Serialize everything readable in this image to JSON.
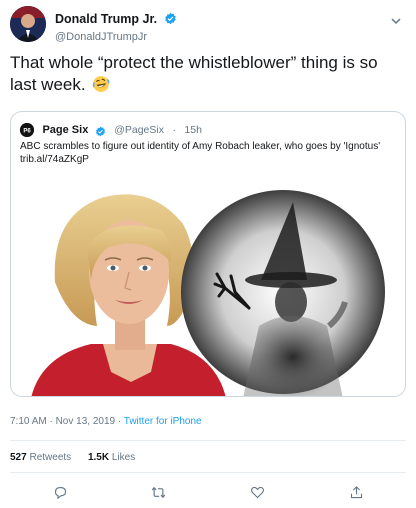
{
  "author": {
    "display_name": "Donald Trump Jr.",
    "handle": "@DonaldJTrumpJr"
  },
  "tweet": {
    "text": "That whole “protect the whistleblower” thing is so last week.",
    "emoji": "rolling-on-floor-laughing"
  },
  "quote": {
    "name": "Page Six",
    "handle": "@PageSix",
    "time": "15h",
    "text": "ABC scrambles to figure out identity of Amy Robach leaker, who goes by 'Ignotus'",
    "link": "trib.al/74aZKgP"
  },
  "meta": {
    "time": "7:10 AM · Nov 13, 2019 · ",
    "source": "Twitter for iPhone"
  },
  "stats": {
    "retweets_count": "527",
    "retweets_label": "Retweets",
    "likes_count": "1.5K",
    "likes_label": "Likes"
  },
  "colors": {
    "accent": "#1da1f2",
    "secondary_text": "#657786",
    "primary_text": "#14171a",
    "border": "#ccd6dd"
  },
  "icons": [
    "verified-badge-icon",
    "chevron-down-icon",
    "reply-icon",
    "retweet-icon",
    "like-icon",
    "share-icon"
  ]
}
